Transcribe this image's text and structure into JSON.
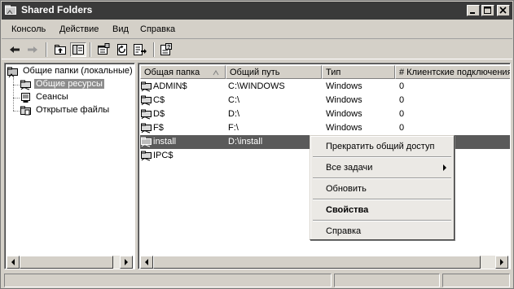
{
  "window": {
    "title": "Shared Folders"
  },
  "menu": [
    "Консоль",
    "Действие",
    "Вид",
    "Справка"
  ],
  "toolbar_icons": [
    "back-arrow-icon",
    "forward-arrow-icon",
    "up-folder-icon",
    "show-hide-tree-icon",
    "properties-icon",
    "refresh-icon",
    "export-list-icon",
    "help-icon"
  ],
  "tree": {
    "root": "Общие папки (локальные)",
    "children": [
      "Общие ресурсы",
      "Сеансы",
      "Открытые файлы"
    ],
    "selected": "Общие ресурсы"
  },
  "list": {
    "columns": [
      "Общая папка",
      "Общий путь",
      "Тип",
      "# Клиентские подключения"
    ],
    "sorted_column": "Общая папка",
    "rows": [
      {
        "name": "ADMIN$",
        "path": "C:\\WINDOWS",
        "type": "Windows",
        "clients": "0"
      },
      {
        "name": "C$",
        "path": "C:\\",
        "type": "Windows",
        "clients": "0"
      },
      {
        "name": "D$",
        "path": "D:\\",
        "type": "Windows",
        "clients": "0"
      },
      {
        "name": "F$",
        "path": "F:\\",
        "type": "Windows",
        "clients": "0"
      },
      {
        "name": "install",
        "path": "D:\\install",
        "type": "",
        "clients": ""
      },
      {
        "name": "IPC$",
        "path": "",
        "type": "",
        "clients": ""
      }
    ],
    "selected_row": "install"
  },
  "context_menu": {
    "items": [
      "Прекратить общий доступ",
      "Все задачи",
      "Обновить",
      "Свойства",
      "Справка"
    ],
    "default_item": "Свойства",
    "submenu_item": "Все задачи"
  }
}
